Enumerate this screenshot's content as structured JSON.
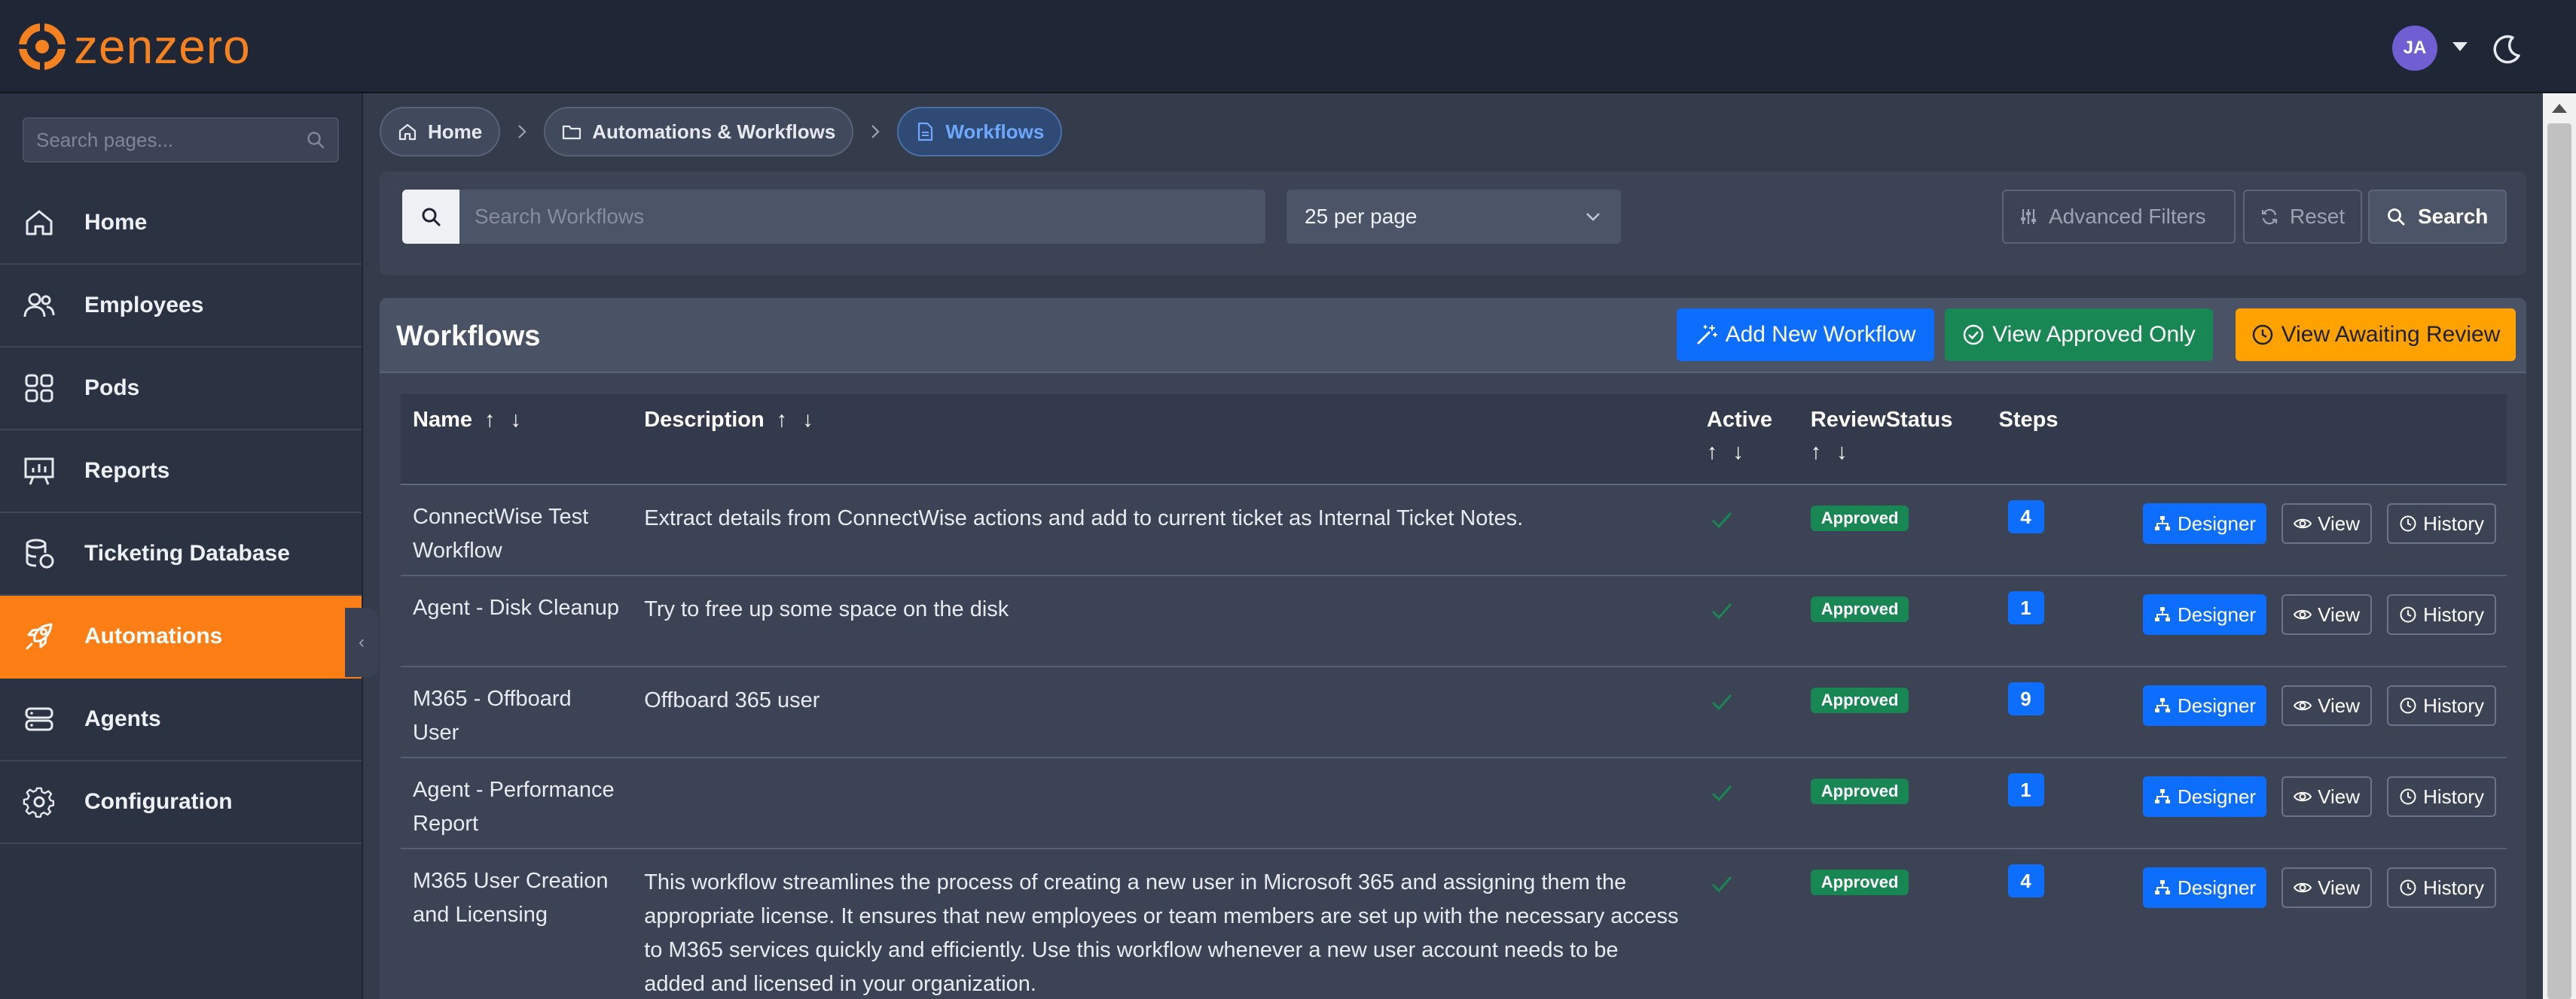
{
  "app": {
    "logo_text": "zenzero",
    "brand_color": "#f48221",
    "user_initials": "JA",
    "theme_toggle_icon": "moon-icon"
  },
  "sidebar": {
    "search_placeholder": "Search pages...",
    "items": [
      {
        "label": "Home",
        "icon": "home-icon",
        "active": false
      },
      {
        "label": "Employees",
        "icon": "users-icon",
        "active": false
      },
      {
        "label": "Pods",
        "icon": "grid-icon",
        "active": false
      },
      {
        "label": "Reports",
        "icon": "chart-board-icon",
        "active": false
      },
      {
        "label": "Ticketing Database",
        "icon": "database-icon",
        "active": false
      },
      {
        "label": "Automations",
        "icon": "rocket-icon",
        "active": true
      },
      {
        "label": "Agents",
        "icon": "server-icon",
        "active": false
      },
      {
        "label": "Configuration",
        "icon": "gear-icon",
        "active": false
      }
    ],
    "active_color": "#fd7e14"
  },
  "breadcrumb": {
    "items": [
      {
        "label": "Home",
        "icon": "home-icon"
      },
      {
        "label": "Automations & Workflows",
        "icon": "folder-icon"
      },
      {
        "label": "Workflows",
        "icon": "file-icon"
      }
    ]
  },
  "filters": {
    "search_placeholder": "Search Workflows",
    "search_value": "",
    "per_page": "25 per page",
    "advanced_label": "Advanced Filters",
    "reset_label": "Reset",
    "search_label": "Search"
  },
  "workflows": {
    "title": "Workflows",
    "add_label": "Add New Workflow",
    "approved_only_label": "View Approved Only",
    "awaiting_label": "View Awaiting Review",
    "columns": {
      "name": "Name",
      "description": "Description",
      "active": "Active",
      "review_status": "ReviewStatus",
      "steps": "Steps"
    },
    "sort_arrows": "↑ ↓",
    "action_labels": {
      "designer": "Designer",
      "view": "View",
      "history": "History"
    },
    "rows": [
      {
        "name": "ConnectWise Test Workflow",
        "description": "Extract details from ConnectWise actions and add to current ticket as Internal Ticket Notes.",
        "active": true,
        "status": "Approved",
        "steps": "4"
      },
      {
        "name": "Agent - Disk Cleanup",
        "description": "Try to free up some space on the disk",
        "active": true,
        "status": "Approved",
        "steps": "1"
      },
      {
        "name": "M365 - Offboard User",
        "description": "Offboard 365 user",
        "active": true,
        "status": "Approved",
        "steps": "9"
      },
      {
        "name": "Agent - Performance Report",
        "description": "",
        "active": true,
        "status": "Approved",
        "steps": "1"
      },
      {
        "name": "M365 User Creation and Licensing",
        "description": "This workflow streamlines the process of creating a new user in Microsoft 365 and assigning them the appropriate license. It ensures that new employees or team members are set up with the necessary access to M365 services quickly and efficiently. Use this workflow whenever a new user account needs to be added and licensed in your organization.",
        "active": true,
        "status": "Approved",
        "steps": "4"
      }
    ]
  }
}
